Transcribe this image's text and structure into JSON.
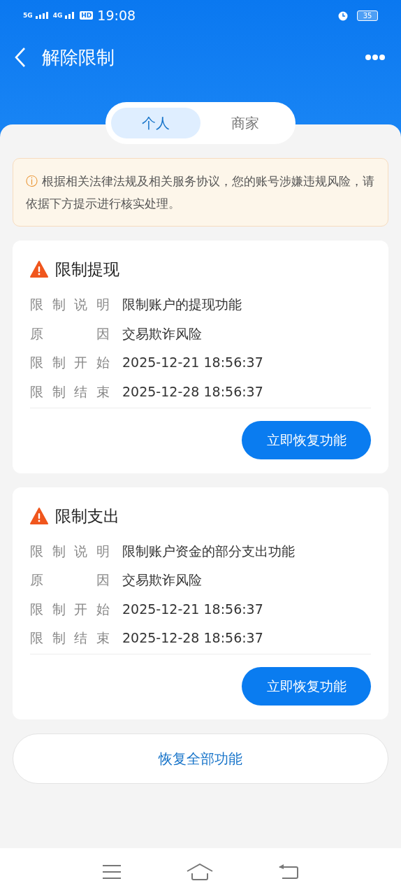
{
  "status_bar": {
    "network_1": "5G",
    "network_2": "4G",
    "hd": "HD",
    "time": "19:08",
    "battery": "35"
  },
  "header": {
    "title": "解除限制"
  },
  "tabs": [
    {
      "label": "个人",
      "selected": true
    },
    {
      "label": "商家",
      "selected": false
    }
  ],
  "notice": {
    "icon": "ⓘ",
    "text": "根据相关法律法规及相关服务协议，您的账号涉嫌违规风险，请依据下方提示进行核实处理。"
  },
  "restrictions": [
    {
      "title": "限制提现",
      "rows": [
        {
          "label": "限制说明",
          "value": "限制账户的提现功能"
        },
        {
          "label": "原因",
          "value": "交易欺诈风险"
        },
        {
          "label": "限制开始",
          "value": "2025-12-21 18:56:37"
        },
        {
          "label": "限制结束",
          "value": "2025-12-28 18:56:37"
        }
      ],
      "button": "立即恢复功能"
    },
    {
      "title": "限制支出",
      "rows": [
        {
          "label": "限制说明",
          "value": "限制账户资金的部分支出功能"
        },
        {
          "label": "原因",
          "value": "交易欺诈风险"
        },
        {
          "label": "限制开始",
          "value": "2025-12-21 18:56:37"
        },
        {
          "label": "限制结束",
          "value": "2025-12-28 18:56:37"
        }
      ],
      "button": "立即恢复功能"
    }
  ],
  "restore_all_button": "恢复全部功能"
}
